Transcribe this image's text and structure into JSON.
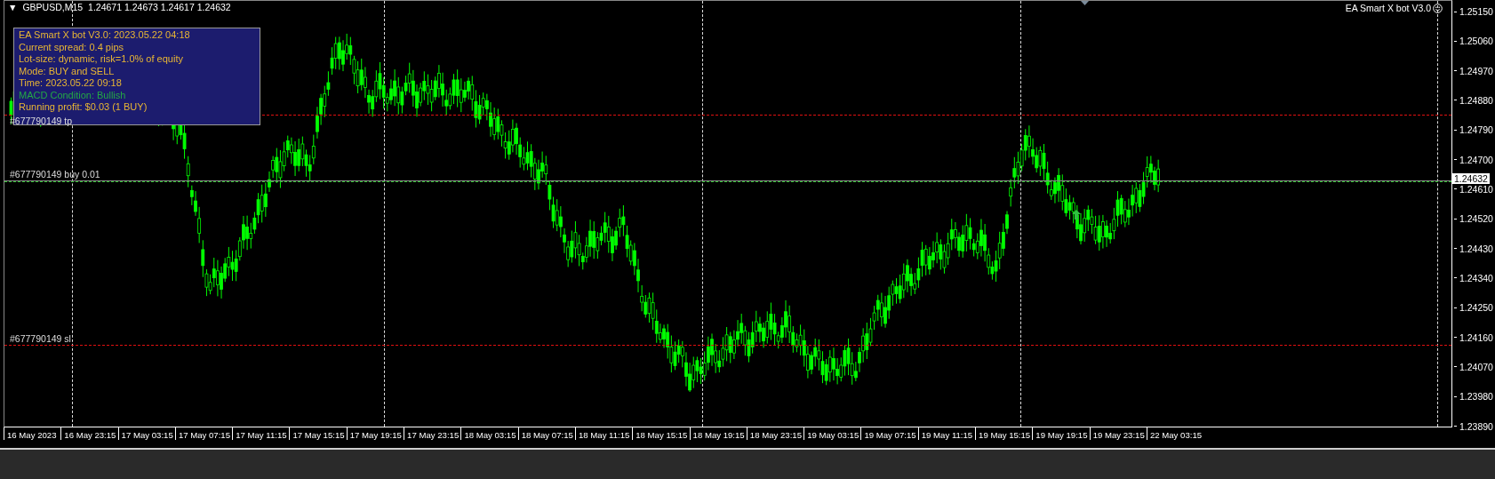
{
  "header": {
    "menu_glyph": "▼",
    "symbol": "GBPUSD,M15",
    "quotes": "1.24671 1.24673 1.24617 1.24632"
  },
  "expert_label": "EA Smart X bot V3.0",
  "info_panel": {
    "lines": [
      {
        "text": "EA Smart X bot V3.0: 2023.05.22 04:18",
        "kind": "info"
      },
      {
        "text": "Current spread: 0.4 pips",
        "kind": "info"
      },
      {
        "text": "Lot-size: dynamic, risk=1.0% of equity",
        "kind": "info"
      },
      {
        "text": "Mode: BUY and SELL",
        "kind": "info"
      },
      {
        "text": "Time: 2023.05.22 09:18",
        "kind": "info"
      },
      {
        "text": "MACD Condition: Bullish",
        "kind": "signal"
      },
      {
        "text": "Running profit: $0.03 (1 BUY)",
        "kind": "info"
      }
    ]
  },
  "order_lines": [
    {
      "label": "#677790149 tp",
      "kind": "tp"
    },
    {
      "label": "#677790149 buy 0.01",
      "kind": "entry"
    },
    {
      "label": "#677790149 sl",
      "kind": "sl"
    }
  ],
  "price_axis": [
    "1.25150",
    "1.25060",
    "1.24970",
    "1.24880",
    "1.24790",
    "1.24700",
    "1.24610",
    "1.24520",
    "1.24430",
    "1.24340",
    "1.24250",
    "1.24160",
    "1.24070",
    "1.23980",
    "1.23890"
  ],
  "current_price": "1.24632",
  "time_axis": [
    "16 May 2023",
    "16 May 23:15",
    "17 May 03:15",
    "17 May 07:15",
    "17 May 11:15",
    "17 May 15:15",
    "17 May 19:15",
    "17 May 23:15",
    "18 May 03:15",
    "18 May 07:15",
    "18 May 11:15",
    "18 May 15:15",
    "18 May 19:15",
    "18 May 23:15",
    "19 May 03:15",
    "19 May 07:15",
    "19 May 11:15",
    "19 May 15:15",
    "19 May 19:15",
    "19 May 23:15",
    "22 May 03:15"
  ]
}
